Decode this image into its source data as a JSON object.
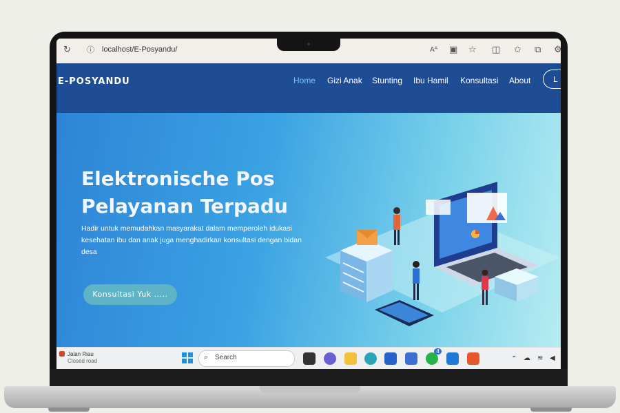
{
  "browser": {
    "url": "localhost/E-Posyandu/",
    "icons": [
      "refresh-icon",
      "info-icon",
      "read-aloud-icon",
      "reader-icon",
      "favorite-icon",
      "split-screen-icon",
      "favorites-icon",
      "collections-icon"
    ]
  },
  "site": {
    "brand": "E-POSYANDU",
    "nav": [
      "Home",
      "Gizi Anak",
      "Stunting",
      "Ibu Hamil",
      "Konsultasi",
      "About"
    ],
    "active_nav": "Home",
    "login_partial": "L",
    "hero": {
      "title_line1": "Elektronische Pos",
      "title_line2": "Pelayanan Terpadu",
      "subtitle": "Hadir untuk memudahkan masyarakat dalam memperoleh idukasi kesehatan ibu dan anak juga menghadirkan konsultasi dengan bidan desa",
      "cta": "Konsultasi Yuk ....."
    }
  },
  "taskbar": {
    "weather_title": "Jalan Riau",
    "weather_sub": "Closed road",
    "search_placeholder": "Search",
    "apps": [
      "windows-start-icon",
      "search-icon",
      "widgets-icon",
      "task-view-icon",
      "teams-icon",
      "file-explorer-icon",
      "edge-icon",
      "store-icon",
      "app-icon",
      "whatsapp-icon",
      "vscode-icon",
      "xampp-icon"
    ],
    "whatsapp_badge": "4"
  },
  "colors": {
    "nav_bg": "#1e4d96",
    "active_link": "#7fc3ff",
    "cta_bg": "#5fb3c7"
  }
}
